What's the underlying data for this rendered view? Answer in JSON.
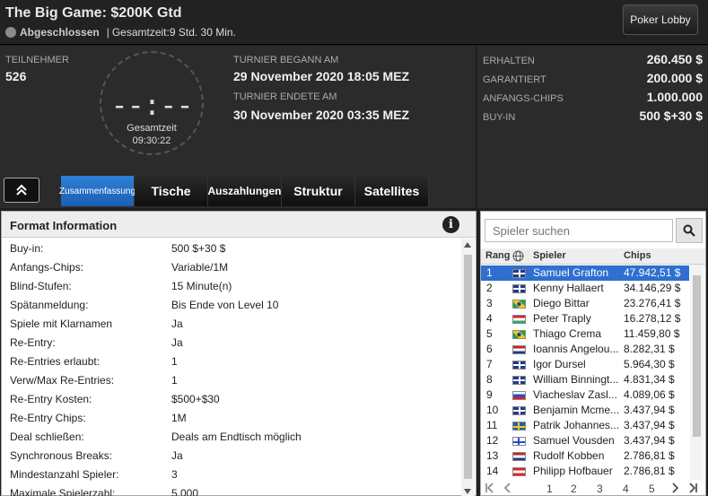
{
  "header": {
    "title": "The Big Game: $200K Gtd",
    "status": "Abgeschlossen",
    "separator": "|",
    "duration": "Gesamtzeit:9 Std.  30 Min.",
    "lobby_button": "Poker Lobby"
  },
  "info": {
    "participants_label": "TEILNEHMER",
    "participants_value": "526",
    "clock_digits": "--:--",
    "clock_label": "Gesamtzeit",
    "clock_value": "09:30:22",
    "start_label": "TURNIER BEGANN AM",
    "start_value": "29 November 2020  18:05 MEZ",
    "end_label": "TURNIER ENDETE AM",
    "end_value": "30 November 2020  03:35 MEZ"
  },
  "stats": [
    {
      "label": "ERHALTEN",
      "value": "260.450 $"
    },
    {
      "label": "GARANTIERT",
      "value": "200.000 $"
    },
    {
      "label": "ANFANGS-CHIPS",
      "value": "1.000.000"
    },
    {
      "label": "BUY-IN",
      "value": "500 $+30 $"
    }
  ],
  "tabs": [
    {
      "label": "Zusammenfassung",
      "active": true
    },
    {
      "label": "Tische",
      "active": false
    },
    {
      "label": "Auszahlungen",
      "active": false
    },
    {
      "label": "Struktur",
      "active": false
    },
    {
      "label": "Satellites",
      "active": false
    }
  ],
  "format": {
    "title": "Format Information",
    "info_icon": "i",
    "rows": [
      {
        "key": "Buy-in:",
        "value": "500 $+30 $"
      },
      {
        "key": "Anfangs-Chips:",
        "value": "Variable/1M"
      },
      {
        "key": "Blind-Stufen:",
        "value": "15 Minute(n)"
      },
      {
        "key": "Spätanmeldung:",
        "value": "Bis Ende von Level 10"
      },
      {
        "key": "Spiele mit Klarnamen",
        "value": "Ja"
      },
      {
        "key": "Re-Entry:",
        "value": "Ja"
      },
      {
        "key": "Re-Entries erlaubt:",
        "value": "1"
      },
      {
        "key": "Verw/Max Re-Entries:",
        "value": "1"
      },
      {
        "key": "Re-Entry Kosten:",
        "value": "$500+$30"
      },
      {
        "key": "Re-Entry Chips:",
        "value": "1M"
      },
      {
        "key": "Deal schließen:",
        "value": "Deals am Endtisch möglich"
      },
      {
        "key": "Synchronous Breaks:",
        "value": "Ja"
      },
      {
        "key": "Mindestanzahl Spieler:",
        "value": "3"
      },
      {
        "key": "Maximale Spielerzahl:",
        "value": "5.000"
      }
    ]
  },
  "players": {
    "search_placeholder": "Spieler suchen",
    "col_rank": "Rang",
    "col_player": "Spieler",
    "col_chips": "Chips",
    "rows": [
      {
        "rank": "1",
        "flag": "gb",
        "name": "Samuel Grafton",
        "chips": "47.942,51 $"
      },
      {
        "rank": "2",
        "flag": "gb",
        "name": "Kenny Hallaert",
        "chips": "34.146,29 $"
      },
      {
        "rank": "3",
        "flag": "br",
        "name": "Diego Bittar",
        "chips": "23.276,41 $"
      },
      {
        "rank": "4",
        "flag": "hu",
        "name": "Peter Traply",
        "chips": "16.278,12 $"
      },
      {
        "rank": "5",
        "flag": "br",
        "name": "Thiago Crema",
        "chips": "11.459,80 $"
      },
      {
        "rank": "6",
        "flag": "nl",
        "name": "Ioannis Angelou...",
        "chips": "8.282,31 $"
      },
      {
        "rank": "7",
        "flag": "gb",
        "name": "Igor Dursel",
        "chips": "5.964,30 $"
      },
      {
        "rank": "8",
        "flag": "gb",
        "name": "William Binningt...",
        "chips": "4.831,34 $"
      },
      {
        "rank": "9",
        "flag": "ru",
        "name": "Viacheslav Zasl...",
        "chips": "4.089,06 $"
      },
      {
        "rank": "10",
        "flag": "gb",
        "name": "Benjamin Mcme...",
        "chips": "3.437,94 $"
      },
      {
        "rank": "11",
        "flag": "se",
        "name": "Patrik Johannes...",
        "chips": "3.437,94 $"
      },
      {
        "rank": "12",
        "flag": "fi",
        "name": "Samuel Vousden",
        "chips": "3.437,94 $"
      },
      {
        "rank": "13",
        "flag": "nl",
        "name": "Rudolf Kobben",
        "chips": "2.786,81 $"
      },
      {
        "rank": "14",
        "flag": "at",
        "name": "Philipp Hofbauer",
        "chips": "2.786,81 $"
      }
    ],
    "pages": [
      "1",
      "2",
      "3",
      "4",
      "5"
    ]
  }
}
